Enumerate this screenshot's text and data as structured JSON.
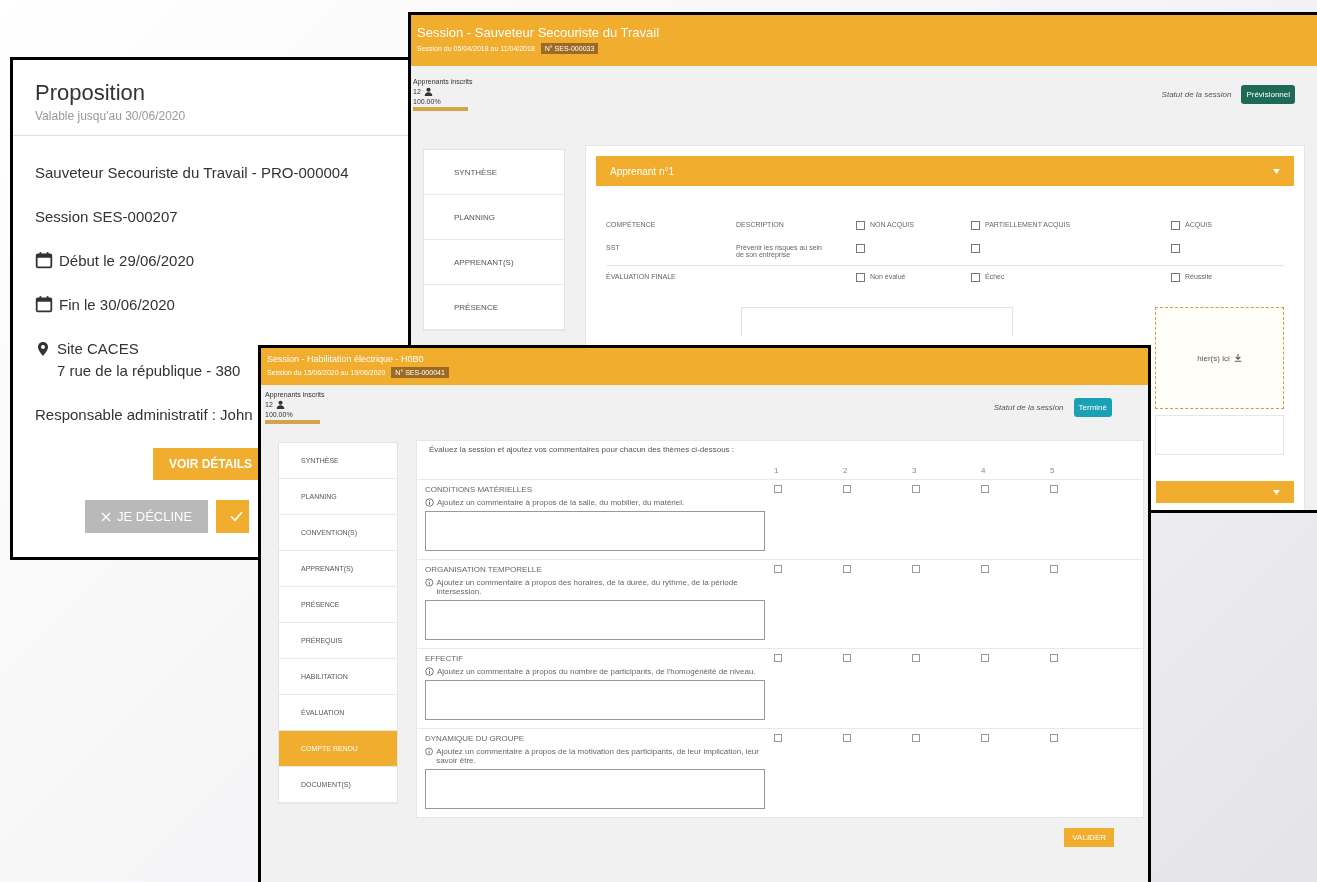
{
  "proposal_window": {
    "title": "Proposition",
    "validity": "Valable jusqu'au 30/06/2020",
    "lines": [
      {
        "kind": "text",
        "text": "Sauveteur Secouriste du Travail - PRO-000004"
      },
      {
        "kind": "text",
        "text": "Session SES-000207"
      },
      {
        "kind": "date",
        "text": "Début le 29/06/2020"
      },
      {
        "kind": "date",
        "text": "Fin le 30/06/2020"
      },
      {
        "kind": "place",
        "text": "Site CACES",
        "address": "7 rue de la république - 380"
      },
      {
        "kind": "text",
        "text": "Responsable administratif : John"
      }
    ],
    "details_button": "VOIR DÉTAILS",
    "decline_button": "JE DÉCLINE"
  },
  "learners_window": {
    "title": "Session - Sauveteur Secouriste du Travail",
    "dates": "Session du 05/04/2018 au 11/04/2018",
    "number": "N° SES-000033",
    "enrolled_label": "Apprenants inscrits",
    "enrolled_count": "12",
    "fill_rate": "100.00%",
    "level": 1,
    "status_label": "Statut de la session",
    "status": "Prévisionnel",
    "menu": [
      {
        "label": "SYNTHÈSE",
        "selected": false
      },
      {
        "label": "PLANNING",
        "selected": false
      },
      {
        "label": "APPRENANT(S)",
        "selected": false
      },
      {
        "label": "PRÉSENCE",
        "selected": false
      }
    ],
    "panel_title": "Apprenant n°1",
    "columns": [
      {
        "label": "COMPÉTENCE"
      },
      {
        "label": "DESCRIPTION"
      },
      {
        "label": "NON ACQUIS",
        "checked": false
      },
      {
        "label": "PARTIELLEMENT ACQUIS",
        "checked": false
      },
      {
        "label": "ACQUIS",
        "checked": false
      }
    ],
    "rows": [
      {
        "skill": "SST",
        "description": "Prévenir les risques au sein de son entreprise",
        "options": [
          {
            "checked": false
          },
          {
            "checked": false
          },
          {
            "checked": false
          }
        ]
      },
      {
        "skill": "ÉVALUATION FINALE",
        "options": [
          {
            "label": "Non évalué",
            "checked": false
          },
          {
            "label": "Échec",
            "checked": false
          },
          {
            "label": "Réussite",
            "checked": false
          }
        ]
      }
    ],
    "dropzone": "hier(s) ici"
  },
  "report_window": {
    "title": "Session - Habilitation électrique - H0B0",
    "dates": "Session du 15/06/2020 au 19/06/2020",
    "number": "N° SES-000041",
    "enrolled_label": "Apprenants inscrits",
    "enrolled_count": "12",
    "fill_rate": "100.00%",
    "level": 1,
    "status_label": "Statut de la session",
    "status": "Terminé",
    "menu": [
      {
        "label": "SYNTHÈSE",
        "selected": false
      },
      {
        "label": "PLANNING",
        "selected": false
      },
      {
        "label": "CONVENTION(S)",
        "selected": false
      },
      {
        "label": "APPRENANT(S)",
        "selected": false
      },
      {
        "label": "PRÉSENCE",
        "selected": false
      },
      {
        "label": "PRÉREQUIS",
        "selected": false
      },
      {
        "label": "HABILITATION",
        "selected": false
      },
      {
        "label": "ÉVALUATION",
        "selected": false
      },
      {
        "label": "COMPTE RENDU",
        "selected": true
      },
      {
        "label": "DOCUMENT(S)",
        "selected": false
      }
    ],
    "intro": "Évaluez la session et ajoutez vos commentaires pour chacun des thèmes ci-dessous :",
    "scale": [
      "1",
      "2",
      "3",
      "4",
      "5"
    ],
    "themes": [
      {
        "title": "CONDITIONS MATÉRIELLES",
        "hint": "Ajoutez un commentaire à propos de la salle, du mobilier, du matériel.",
        "scores": [
          {
            "checked": false
          },
          {
            "checked": false
          },
          {
            "checked": false
          },
          {
            "checked": false
          },
          {
            "checked": false
          }
        ]
      },
      {
        "title": "ORGANISATION TEMPORELLE",
        "hint": "Ajoutez un commentaire à propos des horaires, de la durée, du rythme, de la période intersession.",
        "scores": [
          {
            "checked": false
          },
          {
            "checked": false
          },
          {
            "checked": false
          },
          {
            "checked": false
          },
          {
            "checked": false
          }
        ]
      },
      {
        "title": "EFFECTIF",
        "hint": "Ajoutez un commentaire à propos du nombre de participants, de l'homogénéité de niveau.",
        "scores": [
          {
            "checked": false
          },
          {
            "checked": false
          },
          {
            "checked": false
          },
          {
            "checked": false
          },
          {
            "checked": false
          }
        ]
      },
      {
        "title": "DYNAMIQUE DU GROUPE",
        "hint": "Ajoutez un commentaire à propos de la motivation des participants, de leur implication, leur savoir être.",
        "scores": [
          {
            "checked": false
          },
          {
            "checked": false
          },
          {
            "checked": false
          },
          {
            "checked": false
          },
          {
            "checked": false
          }
        ]
      }
    ],
    "submit_button": "VALIDER"
  }
}
